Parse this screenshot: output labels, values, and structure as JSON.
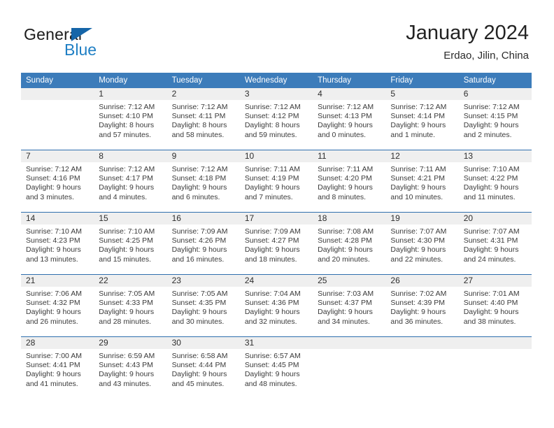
{
  "brand": {
    "word_one": "General",
    "word_two": "Blue",
    "flag_icon": "triangle-flag-icon"
  },
  "header": {
    "title": "January 2024",
    "location": "Erdao, Jilin, China"
  },
  "theme": {
    "header_blue": "#3c7cba",
    "rule_blue": "#2f6fae",
    "daynum_band": "#efefef",
    "brand_blue": "#1f7fc4",
    "text": "#3a3a3a"
  },
  "calendar": {
    "weekdays": [
      "Sunday",
      "Monday",
      "Tuesday",
      "Wednesday",
      "Thursday",
      "Friday",
      "Saturday"
    ],
    "weeks": [
      [
        {
          "day": "",
          "sunrise": "",
          "sunset": "",
          "daylight": ""
        },
        {
          "day": "1",
          "sunrise": "Sunrise: 7:12 AM",
          "sunset": "Sunset: 4:10 PM",
          "daylight": "Daylight: 8 hours and 57 minutes."
        },
        {
          "day": "2",
          "sunrise": "Sunrise: 7:12 AM",
          "sunset": "Sunset: 4:11 PM",
          "daylight": "Daylight: 8 hours and 58 minutes."
        },
        {
          "day": "3",
          "sunrise": "Sunrise: 7:12 AM",
          "sunset": "Sunset: 4:12 PM",
          "daylight": "Daylight: 8 hours and 59 minutes."
        },
        {
          "day": "4",
          "sunrise": "Sunrise: 7:12 AM",
          "sunset": "Sunset: 4:13 PM",
          "daylight": "Daylight: 9 hours and 0 minutes."
        },
        {
          "day": "5",
          "sunrise": "Sunrise: 7:12 AM",
          "sunset": "Sunset: 4:14 PM",
          "daylight": "Daylight: 9 hours and 1 minute."
        },
        {
          "day": "6",
          "sunrise": "Sunrise: 7:12 AM",
          "sunset": "Sunset: 4:15 PM",
          "daylight": "Daylight: 9 hours and 2 minutes."
        }
      ],
      [
        {
          "day": "7",
          "sunrise": "Sunrise: 7:12 AM",
          "sunset": "Sunset: 4:16 PM",
          "daylight": "Daylight: 9 hours and 3 minutes."
        },
        {
          "day": "8",
          "sunrise": "Sunrise: 7:12 AM",
          "sunset": "Sunset: 4:17 PM",
          "daylight": "Daylight: 9 hours and 4 minutes."
        },
        {
          "day": "9",
          "sunrise": "Sunrise: 7:12 AM",
          "sunset": "Sunset: 4:18 PM",
          "daylight": "Daylight: 9 hours and 6 minutes."
        },
        {
          "day": "10",
          "sunrise": "Sunrise: 7:11 AM",
          "sunset": "Sunset: 4:19 PM",
          "daylight": "Daylight: 9 hours and 7 minutes."
        },
        {
          "day": "11",
          "sunrise": "Sunrise: 7:11 AM",
          "sunset": "Sunset: 4:20 PM",
          "daylight": "Daylight: 9 hours and 8 minutes."
        },
        {
          "day": "12",
          "sunrise": "Sunrise: 7:11 AM",
          "sunset": "Sunset: 4:21 PM",
          "daylight": "Daylight: 9 hours and 10 minutes."
        },
        {
          "day": "13",
          "sunrise": "Sunrise: 7:10 AM",
          "sunset": "Sunset: 4:22 PM",
          "daylight": "Daylight: 9 hours and 11 minutes."
        }
      ],
      [
        {
          "day": "14",
          "sunrise": "Sunrise: 7:10 AM",
          "sunset": "Sunset: 4:23 PM",
          "daylight": "Daylight: 9 hours and 13 minutes."
        },
        {
          "day": "15",
          "sunrise": "Sunrise: 7:10 AM",
          "sunset": "Sunset: 4:25 PM",
          "daylight": "Daylight: 9 hours and 15 minutes."
        },
        {
          "day": "16",
          "sunrise": "Sunrise: 7:09 AM",
          "sunset": "Sunset: 4:26 PM",
          "daylight": "Daylight: 9 hours and 16 minutes."
        },
        {
          "day": "17",
          "sunrise": "Sunrise: 7:09 AM",
          "sunset": "Sunset: 4:27 PM",
          "daylight": "Daylight: 9 hours and 18 minutes."
        },
        {
          "day": "18",
          "sunrise": "Sunrise: 7:08 AM",
          "sunset": "Sunset: 4:28 PM",
          "daylight": "Daylight: 9 hours and 20 minutes."
        },
        {
          "day": "19",
          "sunrise": "Sunrise: 7:07 AM",
          "sunset": "Sunset: 4:30 PM",
          "daylight": "Daylight: 9 hours and 22 minutes."
        },
        {
          "day": "20",
          "sunrise": "Sunrise: 7:07 AM",
          "sunset": "Sunset: 4:31 PM",
          "daylight": "Daylight: 9 hours and 24 minutes."
        }
      ],
      [
        {
          "day": "21",
          "sunrise": "Sunrise: 7:06 AM",
          "sunset": "Sunset: 4:32 PM",
          "daylight": "Daylight: 9 hours and 26 minutes."
        },
        {
          "day": "22",
          "sunrise": "Sunrise: 7:05 AM",
          "sunset": "Sunset: 4:33 PM",
          "daylight": "Daylight: 9 hours and 28 minutes."
        },
        {
          "day": "23",
          "sunrise": "Sunrise: 7:05 AM",
          "sunset": "Sunset: 4:35 PM",
          "daylight": "Daylight: 9 hours and 30 minutes."
        },
        {
          "day": "24",
          "sunrise": "Sunrise: 7:04 AM",
          "sunset": "Sunset: 4:36 PM",
          "daylight": "Daylight: 9 hours and 32 minutes."
        },
        {
          "day": "25",
          "sunrise": "Sunrise: 7:03 AM",
          "sunset": "Sunset: 4:37 PM",
          "daylight": "Daylight: 9 hours and 34 minutes."
        },
        {
          "day": "26",
          "sunrise": "Sunrise: 7:02 AM",
          "sunset": "Sunset: 4:39 PM",
          "daylight": "Daylight: 9 hours and 36 minutes."
        },
        {
          "day": "27",
          "sunrise": "Sunrise: 7:01 AM",
          "sunset": "Sunset: 4:40 PM",
          "daylight": "Daylight: 9 hours and 38 minutes."
        }
      ],
      [
        {
          "day": "28",
          "sunrise": "Sunrise: 7:00 AM",
          "sunset": "Sunset: 4:41 PM",
          "daylight": "Daylight: 9 hours and 41 minutes."
        },
        {
          "day": "29",
          "sunrise": "Sunrise: 6:59 AM",
          "sunset": "Sunset: 4:43 PM",
          "daylight": "Daylight: 9 hours and 43 minutes."
        },
        {
          "day": "30",
          "sunrise": "Sunrise: 6:58 AM",
          "sunset": "Sunset: 4:44 PM",
          "daylight": "Daylight: 9 hours and 45 minutes."
        },
        {
          "day": "31",
          "sunrise": "Sunrise: 6:57 AM",
          "sunset": "Sunset: 4:45 PM",
          "daylight": "Daylight: 9 hours and 48 minutes."
        },
        {
          "day": "",
          "sunrise": "",
          "sunset": "",
          "daylight": ""
        },
        {
          "day": "",
          "sunrise": "",
          "sunset": "",
          "daylight": ""
        },
        {
          "day": "",
          "sunrise": "",
          "sunset": "",
          "daylight": ""
        }
      ]
    ]
  }
}
